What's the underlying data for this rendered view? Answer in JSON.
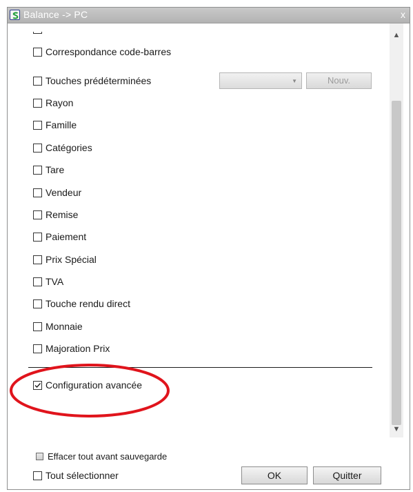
{
  "window": {
    "title": "Balance -> PC",
    "close_label": "x"
  },
  "options": [
    {
      "label": "Correspondance code-barres",
      "checked": false
    },
    {
      "label": "Touches prédéterminées",
      "checked": false
    },
    {
      "label": "Rayon",
      "checked": false
    },
    {
      "label": "Famille",
      "checked": false
    },
    {
      "label": "Catégories",
      "checked": false
    },
    {
      "label": "Tare",
      "checked": false
    },
    {
      "label": "Vendeur",
      "checked": false
    },
    {
      "label": "Remise",
      "checked": false
    },
    {
      "label": "Paiement",
      "checked": false
    },
    {
      "label": "Prix Spécial",
      "checked": false
    },
    {
      "label": "TVA",
      "checked": false
    },
    {
      "label": "Touche rendu direct",
      "checked": false
    },
    {
      "label": "Monnaie",
      "checked": false
    },
    {
      "label": "Majoration Prix",
      "checked": false
    }
  ],
  "touches_combo": {
    "value": ""
  },
  "nouv_button": {
    "label": "Nouv."
  },
  "advanced": {
    "label": "Configuration avancée",
    "checked": true
  },
  "clear_before_save": {
    "label": "Effacer tout avant sauvegarde",
    "checked": false
  },
  "select_all": {
    "label": "Tout sélectionner",
    "checked": false
  },
  "buttons": {
    "ok_label": "OK",
    "quit_label": "Quitter"
  },
  "colors": {
    "highlight_ellipse": "#e0141c",
    "title_bar": "#b8b8b8",
    "scroll_thumb": "#c8c8c8"
  },
  "icons": {
    "app": "app-logo-icon",
    "close": "close-icon",
    "scroll_up": "chevron-up-icon",
    "scroll_down": "chevron-down-icon",
    "combo_arrow": "dropdown-arrow-icon",
    "check": "checkmark-icon"
  }
}
